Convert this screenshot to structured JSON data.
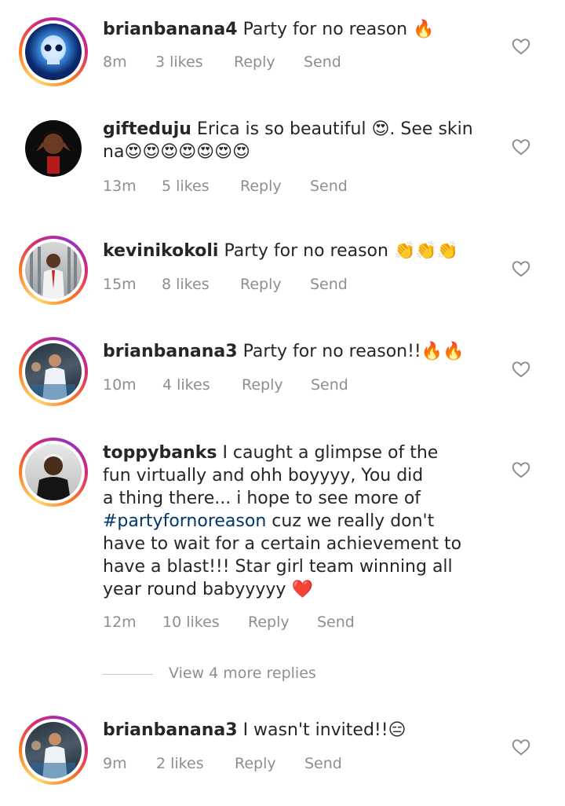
{
  "comments": [
    {
      "username": "brianbanana4",
      "text_lines": [
        "Party for no reason 🔥"
      ],
      "time": "8m",
      "likes": "3 likes",
      "reply": "Reply",
      "send": "Send"
    },
    {
      "username": "gifteduju",
      "text_lines": [
        "Erica is so beautiful 😍. See skin",
        "na😍😍😍😍😍😍😍"
      ],
      "time": "13m",
      "likes": "5 likes",
      "reply": "Reply",
      "send": "Send"
    },
    {
      "username": "kevinikokoli",
      "text_lines": [
        "Party for no reason 👏👏👏"
      ],
      "time": "15m",
      "likes": "8 likes",
      "reply": "Reply",
      "send": "Send"
    },
    {
      "username": "brianbanana3",
      "text_lines": [
        "Party for no reason!!🔥🔥"
      ],
      "time": "10m",
      "likes": "4 likes",
      "reply": "Reply",
      "send": "Send"
    },
    {
      "username": "toppybanks",
      "text_first": "I caught a glimpse of the",
      "text_lines_rest": [
        "fun virtually and ohh boyyyy, You did",
        "a thing there... i hope to see more of"
      ],
      "hashtag": "#partyfornoreason",
      "hashtag_tail": " cuz we really don't",
      "text_lines_end": [
        "have to wait for a certain achievement to",
        "have a blast!!! Star girl team winning all",
        "year round babyyyyy ❤️"
      ],
      "time": "12m",
      "likes": "10 likes",
      "reply": "Reply",
      "send": "Send"
    },
    {
      "username": "brianbanana3",
      "text_lines": [
        "I wasn't invited!!😑"
      ],
      "time": "9m",
      "likes": "2 likes",
      "reply": "Reply",
      "send": "Send"
    }
  ],
  "view_replies": "View 4 more replies",
  "icons": {
    "like": "heart-outline-icon"
  },
  "colors": {
    "text": "#262626",
    "meta": "#8e8e8e",
    "hashtag": "#00376b"
  }
}
